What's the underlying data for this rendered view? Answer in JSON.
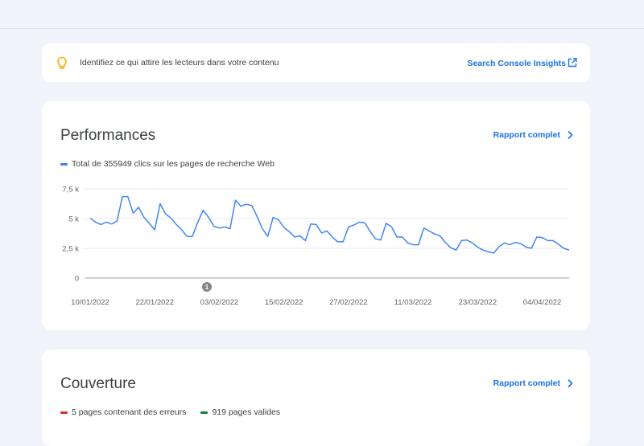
{
  "insight": {
    "text": "Identifiez ce qui attire les lecteurs dans votre contenu",
    "link": "Search Console Insights",
    "icon": "lightbulb-icon",
    "icon_color": "#f9ab00"
  },
  "performance": {
    "title": "Performances",
    "report_link": "Rapport complet",
    "legend_label": "Total de 355949 clics sur les pages de recherche Web",
    "legend_color": "#4285f4",
    "annotation_marker": "1"
  },
  "coverage": {
    "title": "Couverture",
    "report_link": "Rapport complet",
    "legend": [
      {
        "label": "5 pages contenant des erreurs",
        "color": "#d93025"
      },
      {
        "label": "919 pages valides",
        "color": "#188038"
      }
    ]
  },
  "chart_data": {
    "type": "line",
    "ylim": [
      0,
      7500
    ],
    "yticks": [
      0,
      2500,
      5000,
      7500
    ],
    "ytick_labels": [
      "0",
      "2,5 k",
      "5 k",
      "7,5 k"
    ],
    "x_tick_labels": [
      "10/01/2022",
      "22/01/2022",
      "03/02/2022",
      "15/02/2022",
      "27/02/2022",
      "11/03/2022",
      "23/03/2022",
      "04/04/2022"
    ],
    "x_tick_index": [
      0,
      12,
      24,
      36,
      48,
      60,
      72,
      84
    ],
    "series": [
      {
        "color": "#4285f4",
        "values": [
          5050,
          4700,
          4500,
          4700,
          4550,
          4800,
          6850,
          6850,
          5450,
          5950,
          5100,
          4600,
          4050,
          6250,
          5400,
          5050,
          4500,
          4050,
          3500,
          3500,
          4700,
          5700,
          5100,
          4350,
          4200,
          4300,
          4150,
          6550,
          6050,
          6200,
          6100,
          5200,
          4150,
          3500,
          5100,
          4900,
          4250,
          3900,
          3450,
          3550,
          3150,
          4550,
          4500,
          3800,
          3950,
          3450,
          3050,
          3050,
          4300,
          4450,
          4700,
          4650,
          3950,
          3300,
          3200,
          4600,
          4300,
          3450,
          3450,
          2950,
          2800,
          2800,
          4200,
          3950,
          3700,
          3550,
          3000,
          2550,
          2350,
          3150,
          3200,
          2950,
          2600,
          2350,
          2200,
          2100,
          2650,
          2950,
          2800,
          3000,
          2900,
          2600,
          2500,
          3450,
          3400,
          3150,
          3150,
          2850,
          2500,
          2350
        ]
      }
    ]
  }
}
